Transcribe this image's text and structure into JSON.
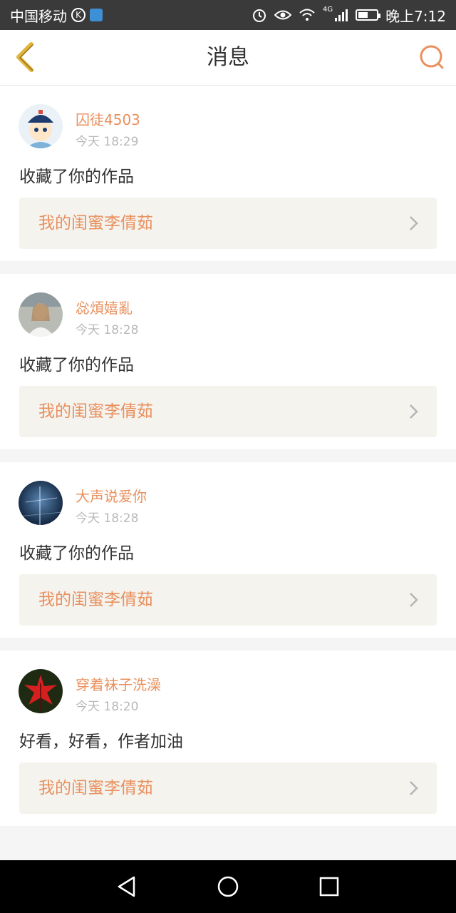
{
  "status_bar": {
    "carrier": "中国移动",
    "k_badge": "K",
    "network": "4G",
    "time": "晚上7:12",
    "battery_level": 0.55
  },
  "header": {
    "title": "消息",
    "back_icon": "chevron-left-icon",
    "chat_icon": "chat-bubble-icon"
  },
  "colors": {
    "accent": "#e9905e",
    "back": "#e2b53a",
    "card_link_bg": "#f4f3ee"
  },
  "messages": [
    {
      "username": "囚徒4503",
      "time": "今天 18:29",
      "text": "收藏了你的作品",
      "work_title": "我的闺蜜李倩茹"
    },
    {
      "username": "惢煩嬉亂",
      "time": "今天 18:28",
      "text": "收藏了你的作品",
      "work_title": "我的闺蜜李倩茹"
    },
    {
      "username": "大声说爱你",
      "time": "今天 18:28",
      "text": "收藏了你的作品",
      "work_title": "我的闺蜜李倩茹"
    },
    {
      "username": "穿着袜子洗澡",
      "time": "今天 18:20",
      "text": "好看，好看，作者加油",
      "work_title": "我的闺蜜李倩茹"
    }
  ],
  "system_nav": {
    "back": "triangle-back-icon",
    "home": "circle-home-icon",
    "recent": "square-recent-icon"
  }
}
